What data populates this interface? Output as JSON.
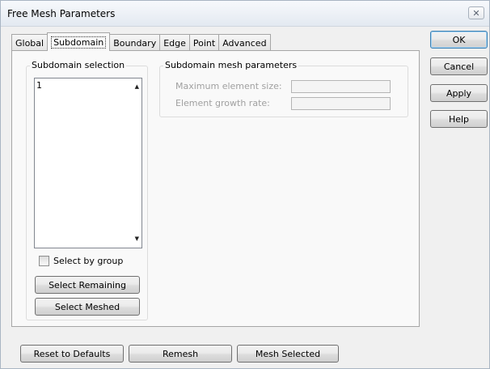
{
  "window": {
    "title": "Free Mesh Parameters",
    "close_glyph": "✕"
  },
  "tabs": [
    {
      "label": "Global"
    },
    {
      "label": "Subdomain"
    },
    {
      "label": "Boundary"
    },
    {
      "label": "Edge"
    },
    {
      "label": "Point"
    },
    {
      "label": "Advanced"
    }
  ],
  "active_tab": "Subdomain",
  "side_buttons": {
    "ok": "OK",
    "cancel": "Cancel",
    "apply": "Apply",
    "help": "Help"
  },
  "subdomain_selection": {
    "title": "Subdomain selection",
    "items": [
      "1"
    ],
    "select_by_group": {
      "label": "Select by group",
      "checked": false
    },
    "select_remaining": "Select Remaining",
    "select_meshed": "Select Meshed"
  },
  "mesh_params": {
    "title": "Subdomain mesh parameters",
    "max_element_size": {
      "label": "Maximum element size:",
      "value": ""
    },
    "growth_rate": {
      "label": "Element growth rate:",
      "value": ""
    }
  },
  "bottom_buttons": {
    "reset": "Reset to Defaults",
    "remesh": "Remesh",
    "mesh_selected": "Mesh Selected"
  },
  "icons": {
    "scroll_up": "▲",
    "scroll_down": "▼"
  }
}
